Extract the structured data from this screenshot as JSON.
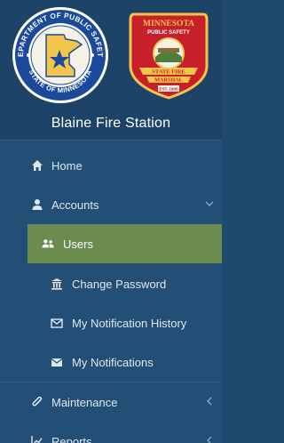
{
  "header": {
    "station_name": "Blaine Fire Station",
    "left_logo": {
      "top_text": "DEPARTMENT OF PUBLIC SAFETY",
      "bottom_text": "STATE OF MINNESOTA",
      "icon": "minnesota-star-seal"
    },
    "right_logo": {
      "line1": "MINNESOTA",
      "line2": "PUBLIC SAFETY",
      "banner1": "STATE FIRE",
      "banner2": "MARSHAL",
      "est": "EST. 1905",
      "icon": "fire-marshal-badge"
    }
  },
  "menu": {
    "home": {
      "label": "Home",
      "icon": "home-icon"
    },
    "accounts": {
      "label": "Accounts",
      "icon": "user-icon",
      "expanded": true,
      "items": [
        {
          "label": "Users",
          "icon": "users-icon",
          "active": true
        },
        {
          "label": "Change Password",
          "icon": "building-icon",
          "active": false
        },
        {
          "label": "My Notification History",
          "icon": "envelope-outline-icon",
          "active": false
        },
        {
          "label": "My Notifications",
          "icon": "envelope-icon",
          "active": false
        }
      ]
    },
    "maintenance": {
      "label": "Maintenance",
      "icon": "paperclip-icon"
    },
    "reports": {
      "label": "Reports",
      "icon": "line-chart-icon"
    }
  },
  "colors": {
    "sidebar_bg": "#234f76",
    "header_bg": "#1d4468",
    "active_item": "#6b8b4f",
    "text": "#dfe8f0"
  }
}
